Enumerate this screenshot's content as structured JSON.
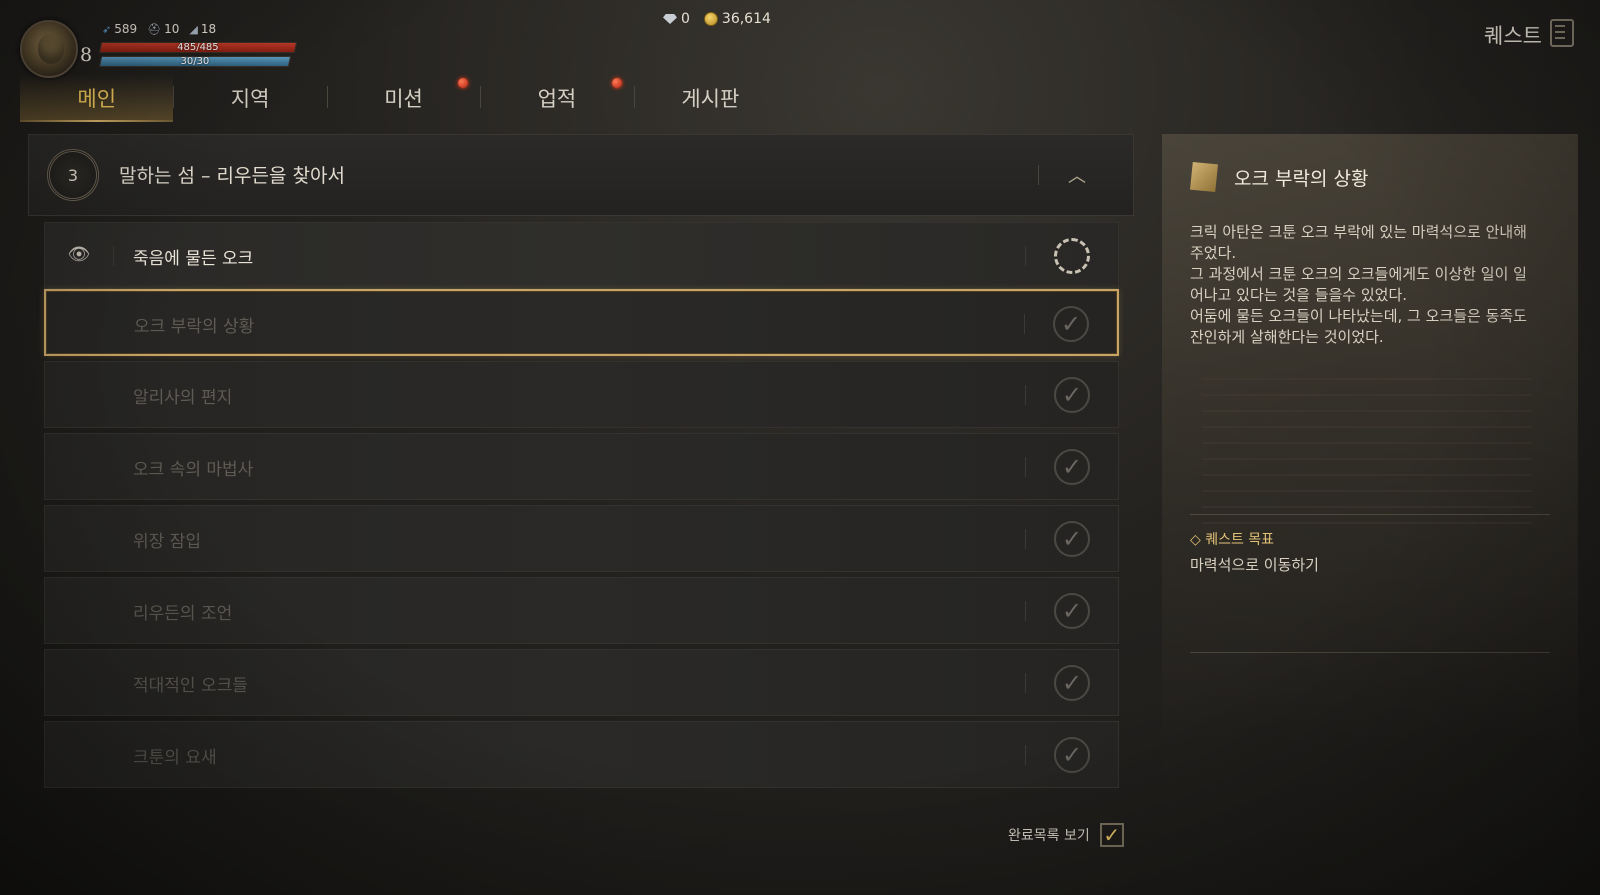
{
  "player": {
    "level": "8",
    "stats": [
      {
        "icon": "feather-icon",
        "value": "589"
      },
      {
        "icon": "helmet-icon",
        "value": "10"
      },
      {
        "icon": "boot-icon",
        "value": "18"
      }
    ],
    "hp": "485/485",
    "mp": "30/30"
  },
  "currency": {
    "gems": "0",
    "gold": "36,614"
  },
  "window": {
    "title": "퀘스트",
    "icon": "quest-book-icon"
  },
  "tabs": [
    {
      "label": "메인",
      "active": true,
      "notify": false
    },
    {
      "label": "지역",
      "active": false,
      "notify": false
    },
    {
      "label": "미션",
      "active": false,
      "notify": true
    },
    {
      "label": "업적",
      "active": false,
      "notify": true
    },
    {
      "label": "게시판",
      "active": false,
      "notify": false
    }
  ],
  "chapter": {
    "number": "3",
    "title": "말하는 섬 – 리우든을 찾아서",
    "collapse_icon": "chevron-up-icon"
  },
  "quests": [
    {
      "label": "죽음에 물든 오크",
      "status": "in-progress",
      "tracked": true
    },
    {
      "label": "오크 부락의 상황",
      "status": "completed",
      "selected": true
    },
    {
      "label": "알리사의 편지",
      "status": "completed"
    },
    {
      "label": "오크 속의 마법사",
      "status": "completed"
    },
    {
      "label": "위장 잠입",
      "status": "completed"
    },
    {
      "label": "리우든의 조언",
      "status": "completed"
    },
    {
      "label": "적대적인 오크들",
      "status": "completed"
    },
    {
      "label": "크툰의 요새",
      "status": "completed"
    }
  ],
  "show_completed": {
    "label": "완료목록 보기",
    "checked": true
  },
  "detail": {
    "icon": "scroll-icon",
    "title": "오크 부락의 상황",
    "description": "크릭 아탄은 크툰 오크 부락에 있는 마력석으로 안내해\n주었다.\n그 과정에서 크툰 오크의 오크들에게도 이상한 일이 일\n어나고 있다는 것을 들을수 있었다.\n어둠에 물든 오크들이 나타났는데, 그 오크들은 동족도\n잔인하게 살해한다는 것이었다.",
    "objective_title": "◇ 퀘스트 목표",
    "objective_text": "마력석으로 이동하기"
  },
  "colors": {
    "accent_gold": "#e9c567",
    "tab_active": "#f0c65a",
    "hp_red": "#c23a27",
    "mp_blue": "#5e9ec4",
    "selection_border": "#c9a565"
  }
}
